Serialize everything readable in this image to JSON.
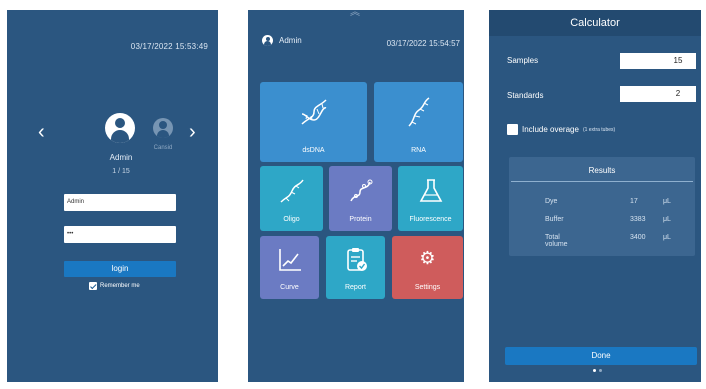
{
  "login": {
    "datetime": "03/17/2022 15:53:49",
    "current_user": "Admin",
    "other_user": "Cansid",
    "pager": "1 / 15",
    "username_value": "Admin",
    "password_value": "•••",
    "login_label": "login",
    "remember_label": "Remember me",
    "remember_checked": true
  },
  "home": {
    "user": "Admin",
    "datetime": "03/17/2022 15:54:57",
    "tiles": [
      {
        "label": "dsDNA",
        "icon": "dna-helix-icon"
      },
      {
        "label": "RNA",
        "icon": "rna-strand-icon"
      },
      {
        "label": "Oligo",
        "icon": "oligo-icon"
      },
      {
        "label": "Protein",
        "icon": "protein-icon"
      },
      {
        "label": "Fluorescence",
        "icon": "flask-icon"
      },
      {
        "label": "Curve",
        "icon": "chart-line-icon"
      },
      {
        "label": "Report",
        "icon": "clipboard-check-icon"
      },
      {
        "label": "Settings",
        "icon": "gear-icon"
      }
    ],
    "colors": {
      "blue_tile": "#3b8fcf",
      "teal_tile": "#2ea7c7",
      "purple_tile": "#6b7bc3",
      "settings_tile": "#cf5c5c"
    }
  },
  "calculator": {
    "title": "Calculator",
    "samples_label": "Samples",
    "samples_value": "15",
    "standards_label": "Standards",
    "standards_value": "2",
    "overage_label": "Include overage",
    "overage_note": "(1 extra tubes)",
    "results_title": "Results",
    "results": [
      {
        "name": "Dye",
        "value": "17",
        "unit": "μL"
      },
      {
        "name": "Buffer",
        "value": "3383",
        "unit": "μL"
      },
      {
        "name": "Total volume",
        "value": "3400",
        "unit": "μL"
      }
    ],
    "done_label": "Done"
  },
  "colors": {
    "background": "#2b5680",
    "accent": "#1a78c2"
  }
}
